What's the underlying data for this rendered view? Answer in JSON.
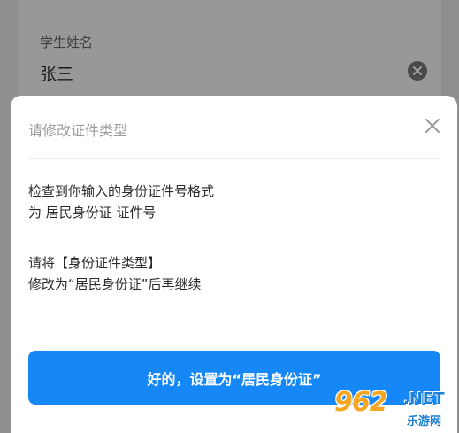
{
  "background_form": {
    "field_label": "学生姓名",
    "field_value": "张三",
    "clear_icon": "clear-circle-icon"
  },
  "dialog": {
    "title": "请修改证件类型",
    "close_icon": "close-icon",
    "message_lines": [
      "检查到你输入的身份证件号格式",
      "为 居民身份证 证件号",
      "请将【身份证件类型】",
      "修改为“居民身份证”后再继续"
    ],
    "confirm_label": "好的，设置为“居民身份证”",
    "confirm_color": "#1587f6"
  },
  "watermark": {
    "number": "962",
    "suffix": ".NET",
    "subtitle": "乐游网"
  }
}
